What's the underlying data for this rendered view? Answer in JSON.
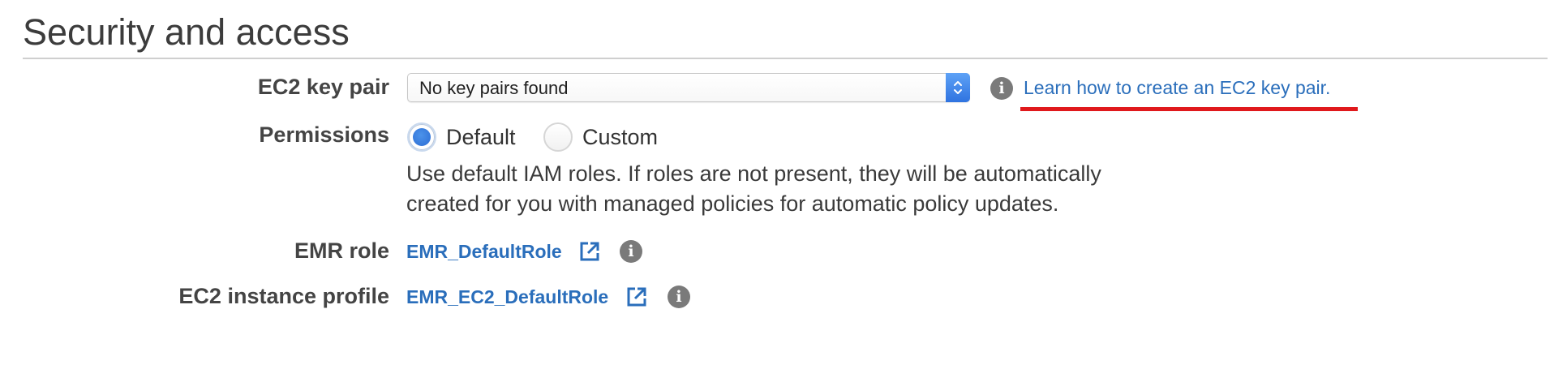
{
  "section": {
    "title": "Security and access"
  },
  "key_pair": {
    "label": "EC2 key pair",
    "selected": "No key pairs found",
    "info_icon": "info-icon",
    "help_link": "Learn how to create an EC2 key pair."
  },
  "permissions": {
    "label": "Permissions",
    "options": [
      {
        "label": "Default",
        "selected": true
      },
      {
        "label": "Custom",
        "selected": false
      }
    ],
    "description": "Use default IAM roles. If roles are not present, they will be automatically created for you with managed policies for automatic policy updates."
  },
  "emr_role": {
    "label": "EMR role",
    "value": "EMR_DefaultRole",
    "icon": "external-link-icon",
    "info_icon": "info-icon"
  },
  "instance_profile": {
    "label": "EC2 instance profile",
    "value": "EMR_EC2_DefaultRole",
    "icon": "external-link-icon",
    "info_icon": "info-icon"
  },
  "colors": {
    "link": "#2a6ebb",
    "radio_selected": "#2b6cd4",
    "annotation_underline": "#e0191c",
    "info_icon": "#7a7a7a"
  }
}
